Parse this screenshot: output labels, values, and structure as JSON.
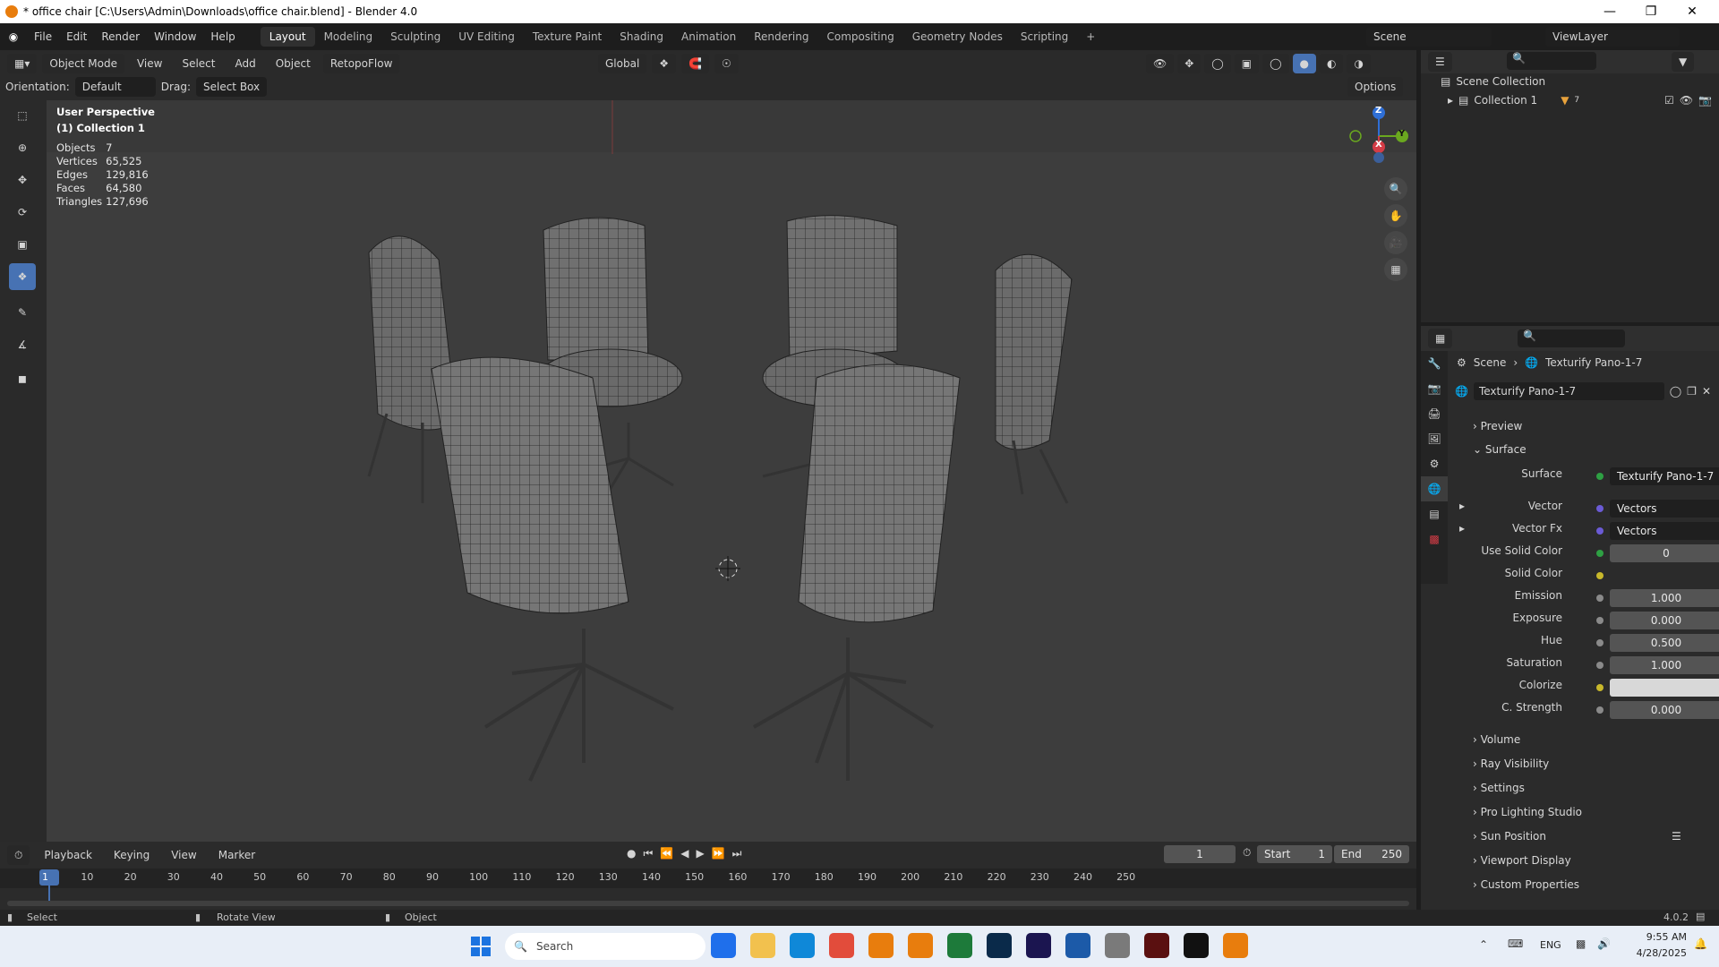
{
  "window": {
    "title": "* office chair [C:\\Users\\Admin\\Downloads\\office chair.blend] - Blender 4.0"
  },
  "menu": [
    "File",
    "Edit",
    "Render",
    "Window",
    "Help"
  ],
  "workspaces": [
    "Layout",
    "Modeling",
    "Sculpting",
    "UV Editing",
    "Texture Paint",
    "Shading",
    "Animation",
    "Rendering",
    "Compositing",
    "Geometry Nodes",
    "Scripting"
  ],
  "scene": {
    "label": "Scene",
    "view_layer": "ViewLayer"
  },
  "viewport_header": {
    "mode": "Object Mode",
    "view": "View",
    "select": "Select",
    "add": "Add",
    "object": "Object",
    "addon": "RetopoFlow",
    "transform": "Global",
    "orientation_label": "Orientation:",
    "orientation_value": "Default",
    "drag_label": "Drag:",
    "drag_value": "Select Box",
    "options": "Options"
  },
  "overlay": {
    "perspective": "User Perspective",
    "collection": "(1) Collection 1",
    "stats": [
      {
        "label": "Objects",
        "value": "7"
      },
      {
        "label": "Vertices",
        "value": "65,525"
      },
      {
        "label": "Edges",
        "value": "129,816"
      },
      {
        "label": "Faces",
        "value": "64,580"
      },
      {
        "label": "Triangles",
        "value": "127,696"
      }
    ]
  },
  "gizmo": {
    "z": "Z",
    "y": "Y",
    "x": "X"
  },
  "outliner": {
    "root": "Scene Collection",
    "collection": "Collection 1",
    "count": "7"
  },
  "properties": {
    "breadcrumb_scene": "Scene",
    "breadcrumb_world": "Texturify Pano-1-7",
    "world_name": "Texturify Pano-1-7",
    "panels_top": [
      "Preview",
      "Surface"
    ],
    "rows": [
      {
        "label": "Surface",
        "value": "Texturify Pano-1-7",
        "dot": "#2ea043"
      },
      {
        "label": "Vector",
        "value": "Vectors",
        "dot": "#6b5bd6"
      },
      {
        "label": "Vector Fx",
        "value": "Vectors",
        "dot": "#6b5bd6"
      },
      {
        "label": "Use Solid Color",
        "value": "0",
        "dot": "#8a8a8a"
      },
      {
        "label": "Solid Color",
        "value": "",
        "dot": "#c8b82b"
      },
      {
        "label": "Emission",
        "value": "1.000",
        "dot": "#8a8a8a"
      },
      {
        "label": "Exposure",
        "value": "0.000",
        "dot": "#8a8a8a"
      },
      {
        "label": "Hue",
        "value": "0.500",
        "dot": "#8a8a8a"
      },
      {
        "label": "Saturation",
        "value": "1.000",
        "dot": "#8a8a8a"
      },
      {
        "label": "Colorize",
        "value": "",
        "dot": "#c8b82b"
      },
      {
        "label": "C. Strength",
        "value": "0.000",
        "dot": "#8a8a8a"
      }
    ],
    "panels_bottom": [
      "Volume",
      "Ray Visibility",
      "Settings",
      "Pro Lighting Studio",
      "Sun Position",
      "Viewport Display",
      "Custom Properties"
    ]
  },
  "timeline": {
    "menus": [
      "Playback",
      "Keying",
      "View",
      "Marker"
    ],
    "current_frame": "1",
    "start_label": "Start",
    "start": "1",
    "end_label": "End",
    "end": "250",
    "ticks": [
      "1",
      "10",
      "20",
      "30",
      "40",
      "50",
      "60",
      "70",
      "80",
      "90",
      "100",
      "110",
      "120",
      "130",
      "140",
      "150",
      "160",
      "170",
      "180",
      "190",
      "200",
      "210",
      "220",
      "230",
      "240",
      "250"
    ]
  },
  "statusbar": {
    "select": "Select",
    "rotate": "Rotate View",
    "object": "Object",
    "version": "4.0.2"
  },
  "taskbar": {
    "search_placeholder": "Search",
    "lang": "ENG",
    "time": "9:55 AM",
    "date": "4/28/2025"
  }
}
